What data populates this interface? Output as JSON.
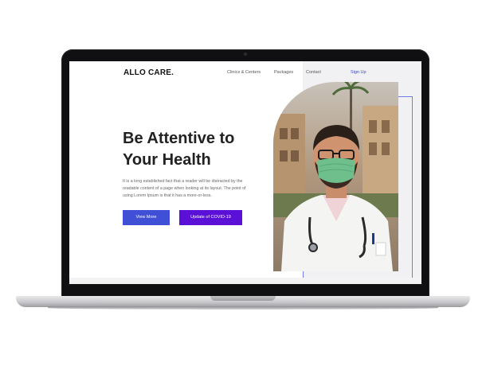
{
  "site": {
    "logo": "ALLO CARE.",
    "nav": {
      "item1": "Clinics & Centers",
      "item2": "Packages",
      "item3": "Contact",
      "signup": "Sign Up"
    },
    "hero": {
      "title_line1": "Be Attentive to",
      "title_line2": "Your Health",
      "body": "It is a long established fact that a reader will be distracted by the readable content of a page when looking at its layout. The point of using Lorem Ipsum is that it has a more-or-less.",
      "button_view": "View More",
      "button_covid": "Update of COVID-19"
    }
  },
  "colors": {
    "accent_blue": "#3f4fd6",
    "accent_purple": "#5a10d6",
    "mask_green": "#6fbf8c"
  },
  "icons": {
    "camera": "camera-icon",
    "doctor_photo": "doctor-photo"
  }
}
